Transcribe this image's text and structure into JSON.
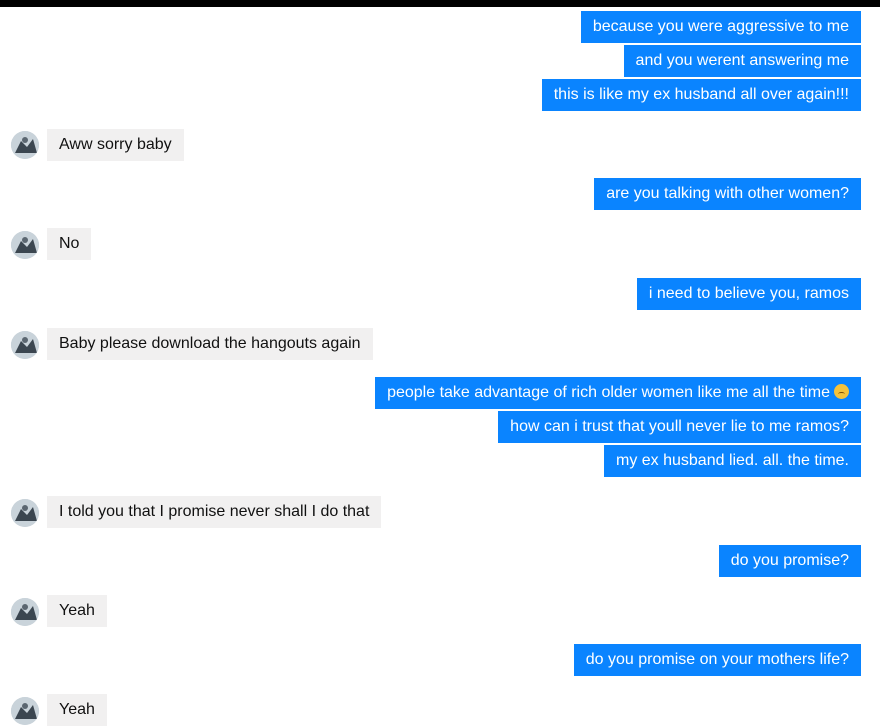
{
  "messages": [
    {
      "dir": "out",
      "text": "because you were aggressive to me"
    },
    {
      "dir": "out",
      "text": "and you werent answering me"
    },
    {
      "dir": "out",
      "text": "this is like my ex husband all over again!!!"
    },
    {
      "dir": "in",
      "text": "Aww sorry baby"
    },
    {
      "dir": "out",
      "text": "are you talking with other women?"
    },
    {
      "dir": "in",
      "text": "No"
    },
    {
      "dir": "out",
      "text": "i need to believe you, ramos"
    },
    {
      "dir": "in",
      "text": "Baby please download the hangouts again"
    },
    {
      "dir": "out",
      "text": "people take advantage of rich older women like me all the time",
      "icon": "disappointed-face-emoji"
    },
    {
      "dir": "out",
      "text": "how can i trust that youll never lie to me ramos?"
    },
    {
      "dir": "out",
      "text": "my ex husband lied. all. the time."
    },
    {
      "dir": "in",
      "text": "I told you that I promise never shall I do that"
    },
    {
      "dir": "out",
      "text": "do you promise?"
    },
    {
      "dir": "in",
      "text": "Yeah"
    },
    {
      "dir": "out",
      "text": "do you promise on your mothers life?"
    },
    {
      "dir": "in",
      "text": "Yeah"
    }
  ],
  "colors": {
    "outgoing": "#0a84ff",
    "incoming": "#f1f0f0",
    "background": "#ffffff"
  }
}
